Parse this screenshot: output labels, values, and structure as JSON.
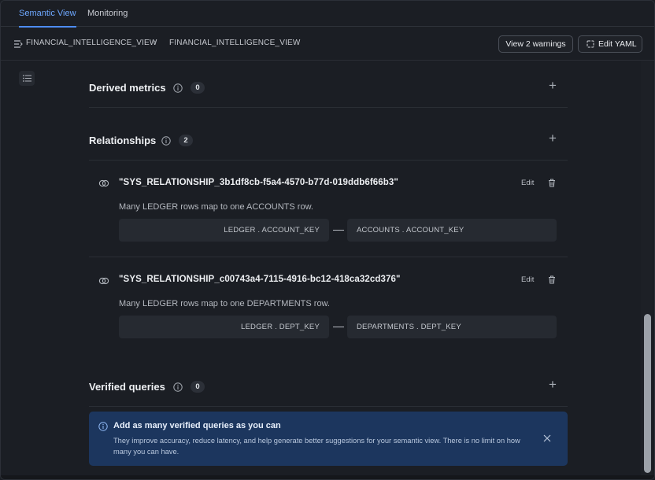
{
  "tabs": [
    {
      "label": "Semantic View",
      "active": true
    },
    {
      "label": "Monitoring",
      "active": false
    }
  ],
  "breadcrumb": {
    "items": [
      "FINANCIAL_INTELLIGENCE_VIEW",
      "FINANCIAL_INTELLIGENCE_VIEW"
    ],
    "separator_icon": "chevron-right-icon",
    "leading_icon": "semantic-view-icon"
  },
  "toolbar": {
    "warnings_label": "View 2 warnings",
    "edit_yaml_label": "Edit YAML",
    "edit_yaml_icon": "edit-document-icon"
  },
  "sidebar": {
    "toggle_icon": "list-icon"
  },
  "sections": {
    "derived_metrics": {
      "title": "Derived metrics",
      "count": "0"
    },
    "relationships": {
      "title": "Relationships",
      "count": "2"
    },
    "verified_queries": {
      "title": "Verified queries",
      "count": "0"
    }
  },
  "relationships": [
    {
      "name": "\"SYS_RELATIONSHIP_3b1df8cb-f5a4-4570-b77d-019ddb6f66b3\"",
      "edit_label": "Edit",
      "description": "Many LEDGER rows map to one ACCOUNTS row.",
      "left_key": "LEDGER . ACCOUNT_KEY",
      "right_key": "ACCOUNTS . ACCOUNT_KEY"
    },
    {
      "name": "\"SYS_RELATIONSHIP_c00743a4-7115-4916-bc12-418ca32cd376\"",
      "edit_label": "Edit",
      "description": "Many LEDGER rows map to one DEPARTMENTS row.",
      "left_key": "LEDGER . DEPT_KEY",
      "right_key": "DEPARTMENTS . DEPT_KEY"
    }
  ],
  "banner": {
    "title": "Add as many verified queries as you can",
    "body": "They improve accuracy, reduce latency, and help generate better suggestions for your semantic view. There is no limit on how many you can have.",
    "icon": "info-icon",
    "close_icon": "close-icon"
  },
  "colors": {
    "background": "#1b1e24",
    "accent": "#4d8cf5",
    "banner": "#1c365e"
  }
}
